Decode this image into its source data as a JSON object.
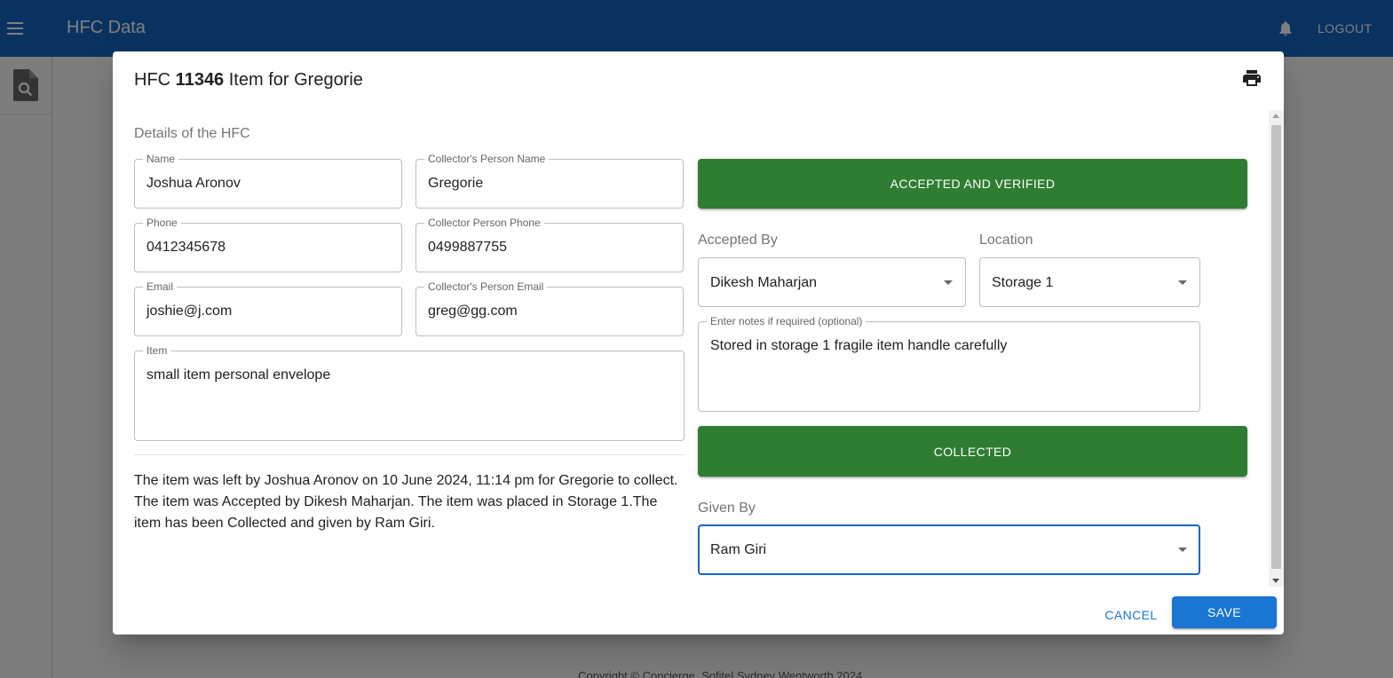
{
  "app": {
    "title": "HFC Data",
    "logout_label": "LOGOUT",
    "footer": "Copyright © Concierge, Sofitel Sydney Wentworth 2024."
  },
  "colors": {
    "appbar": "#1565c0",
    "status_green": "#2e7d32",
    "primary": "#1976d2"
  },
  "icons": {
    "menu": "menu-icon",
    "notifications": "bell-icon",
    "rail_search": "document-search-icon",
    "print": "print-icon"
  },
  "dialog": {
    "title_prefix": "HFC",
    "hfc_number": "11346",
    "title_suffix": "Item for Gregorie",
    "section_label": "Details of the HFC",
    "fields": {
      "name": {
        "label": "Name",
        "value": "Joshua Aronov"
      },
      "collector_name": {
        "label": "Collector's Person Name",
        "value": "Gregorie"
      },
      "phone": {
        "label": "Phone",
        "value": "0412345678"
      },
      "collector_phone": {
        "label": "Collector Person Phone",
        "value": "0499887755"
      },
      "email": {
        "label": "Email",
        "value": "joshie@j.com"
      },
      "collector_email": {
        "label": "Collector's Person Email",
        "value": "greg@gg.com"
      },
      "item": {
        "label": "Item",
        "value": "small item personal envelope"
      }
    },
    "summary": "The item was left by Joshua Aronov on 10 June 2024, 11:14 pm for Gregorie to collect. The item was Accepted by Dikesh Maharjan. The item was placed in Storage 1.The item has been Collected and given by Ram Giri.",
    "accepted_button": "ACCEPTED AND VERIFIED",
    "accepted_by": {
      "label": "Accepted By",
      "value": "Dikesh Maharjan"
    },
    "location": {
      "label": "Location",
      "value": "Storage 1"
    },
    "notes": {
      "label": "Enter notes if required (optional)",
      "value": "Stored in storage 1 fragile item handle carefully"
    },
    "collected_button": "COLLECTED",
    "given_by": {
      "label": "Given By",
      "value": "Ram Giri"
    },
    "cancel_label": "CANCEL",
    "save_label": "SAVE"
  }
}
